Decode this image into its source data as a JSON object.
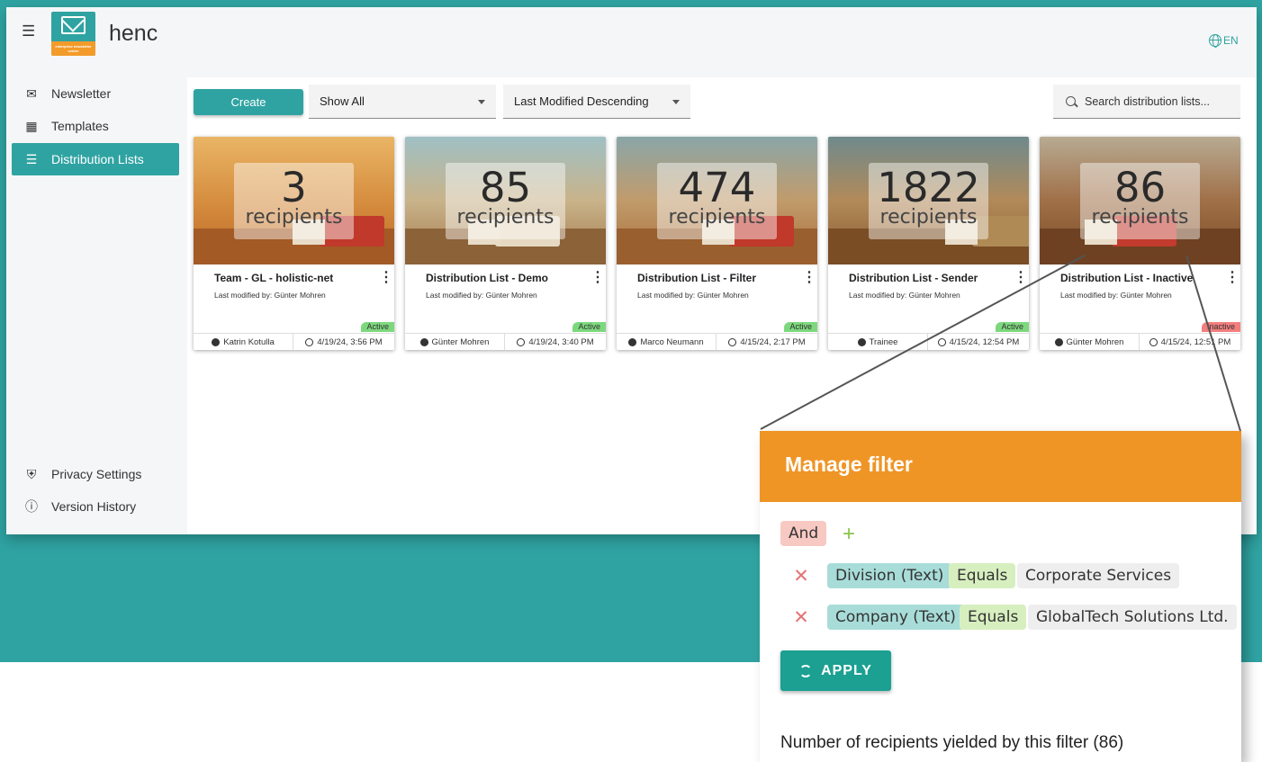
{
  "app": {
    "brand": "henc",
    "logo_text": "enterprise newsletter center",
    "language": "EN"
  },
  "sidebar": {
    "items": [
      {
        "label": "Newsletter",
        "icon": "envelope-icon"
      },
      {
        "label": "Templates",
        "icon": "books-icon"
      },
      {
        "label": "Distribution Lists",
        "icon": "list-icon",
        "active": true
      }
    ],
    "footer_items": [
      {
        "label": "Privacy Settings",
        "icon": "shield-icon"
      },
      {
        "label": "Version History",
        "icon": "info-icon"
      }
    ]
  },
  "toolbar": {
    "create_label": "Create",
    "filter_select": "Show All",
    "sort_select": "Last Modified Descending",
    "search_placeholder": "Search distribution lists..."
  },
  "cards": [
    {
      "count": "3",
      "count_label": "recipients",
      "title": "Team - GL - holistic-net",
      "modified": "Last modified by: Günter Mohren",
      "status": "Active",
      "user": "Katrin Kotulla",
      "date": "4/19/24, 3:56 PM"
    },
    {
      "count": "85",
      "count_label": "recipients",
      "title": "Distribution List - Demo",
      "modified": "Last modified by: Günter Mohren",
      "status": "Active",
      "user": "Günter Mohren",
      "date": "4/19/24, 3:40 PM"
    },
    {
      "count": "474",
      "count_label": "recipients",
      "title": "Distribution List - Filter",
      "modified": "Last modified by: Günter Mohren",
      "status": "Active",
      "user": "Marco Neumann",
      "date": "4/15/24, 2:17 PM"
    },
    {
      "count": "1822",
      "count_label": "recipients",
      "title": "Distribution List - Sender",
      "modified": "Last modified by: Günter Mohren",
      "status": "Active",
      "user": "Trainee",
      "date": "4/15/24, 12:54 PM"
    },
    {
      "count": "86",
      "count_label": "recipients",
      "title": "Distribution List - Inactive",
      "modified": "Last modified by: Günter Mohren",
      "status": "Inactive",
      "user": "Günter Mohren",
      "date": "4/15/24, 12:51 PM"
    }
  ],
  "filter_panel": {
    "title": "Manage filter",
    "logic": "And",
    "rules": [
      {
        "field": "Division (Text)",
        "operator": "Equals",
        "value": "Corporate Services"
      },
      {
        "field": "Company (Text)",
        "operator": "Equals",
        "value": "GlobalTech Solutions Ltd."
      }
    ],
    "apply_label": "APPLY",
    "yield_text": "Number of recipients yielded by this filter (86)"
  },
  "colors": {
    "accent": "#2fa3a2",
    "panel_header": "#ef9526",
    "active": "#7dd87d",
    "inactive": "#f37e7e"
  }
}
